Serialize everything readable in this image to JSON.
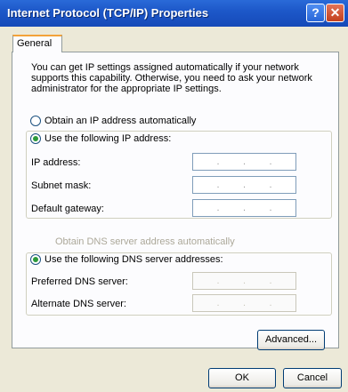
{
  "window": {
    "title": "Internet Protocol (TCP/IP) Properties",
    "help_label": "?",
    "close_label": "✕"
  },
  "tabs": [
    {
      "label": "General"
    }
  ],
  "description": "You can get IP settings assigned automatically if your network supports this capability. Otherwise, you need to ask your network administrator for the appropriate IP settings.",
  "ip_options": {
    "auto_label": "Obtain an IP address automatically",
    "manual_label": "Use the following IP address:",
    "selected": "manual"
  },
  "ip_fields": {
    "ip_address_label": "IP address:",
    "subnet_mask_label": "Subnet mask:",
    "default_gateway_label": "Default gateway:",
    "ip_address_value": "",
    "subnet_mask_value": "",
    "default_gateway_value": ""
  },
  "dns_options": {
    "auto_label": "Obtain DNS server address automatically",
    "manual_label": "Use the following DNS server addresses:",
    "selected": "manual"
  },
  "dns_fields": {
    "preferred_label": "Preferred DNS server:",
    "alternate_label": "Alternate DNS server:",
    "preferred_value": "",
    "alternate_value": ""
  },
  "buttons": {
    "advanced": "Advanced...",
    "ok": "OK",
    "cancel": "Cancel"
  },
  "icons": {
    "help": "help-icon",
    "close": "close-icon"
  },
  "colors": {
    "title_bar": "#1d58c9",
    "dialog_bg": "#ece9d8",
    "tab_highlight": "#f3a23a",
    "radio_checked": "#2b9a3a"
  }
}
